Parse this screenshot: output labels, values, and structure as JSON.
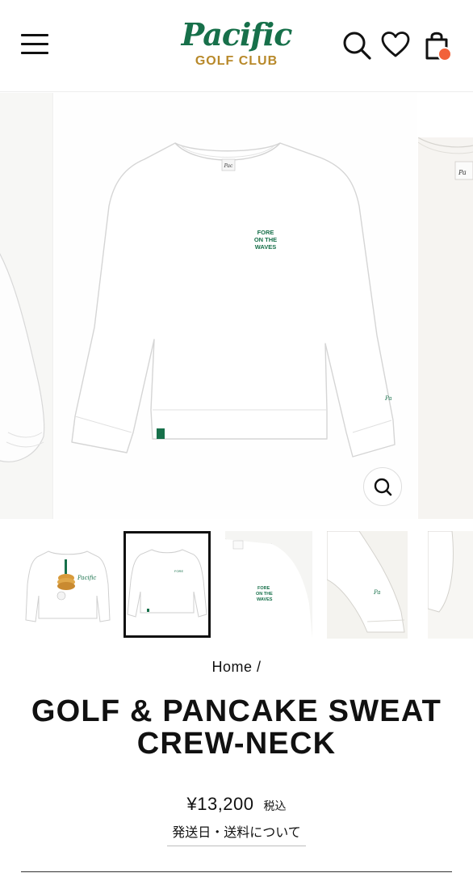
{
  "header": {
    "logo_script": "Pacific",
    "logo_sub": "GOLF CLUB",
    "icons": [
      "menu-icon",
      "search-icon",
      "heart-icon",
      "cart-icon"
    ]
  },
  "gallery": {
    "main_print_text": "FORE\nON THE\nWAVES",
    "tag_text": "Pacific"
  },
  "thumbnails": [
    {
      "name": "back-pancake-print"
    },
    {
      "name": "front-crew-neck",
      "selected": true
    },
    {
      "name": "chest-print-detail"
    },
    {
      "name": "sleeve-detail"
    },
    {
      "name": "sleeve-cuff"
    }
  ],
  "breadcrumb": {
    "home": "Home",
    "separator": "/"
  },
  "product": {
    "title": "GOLF & PANCAKE SWEAT CREW-NECK",
    "price": "¥13,200",
    "tax_label": "税込",
    "shipping_link": "発送日・送料について"
  },
  "colors": {
    "brand_green": "#17704a",
    "brand_gold": "#b8892a",
    "cart_badge": "#f2623a"
  }
}
